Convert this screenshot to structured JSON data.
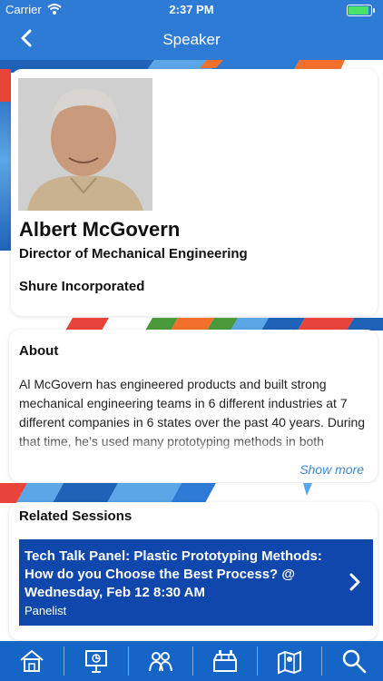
{
  "status_bar": {
    "carrier": "Carrier",
    "time": "2:37 PM"
  },
  "nav": {
    "title": "Speaker"
  },
  "speaker": {
    "name": "Albert McGovern",
    "job_title": "Director of Mechanical Engineering",
    "company": "Shure Incorporated"
  },
  "about": {
    "heading": "About",
    "text": "Al McGovern has engineered products and built strong mechanical engineering teams in 6 different industries at 7 different companies in 6 states over the past 40 years. During that time, he’s used many prototyping methods in both Research and in Product Development efforts. These include",
    "show_more": "Show more"
  },
  "related": {
    "heading": "Related Sessions",
    "sessions": [
      {
        "title": "Tech Talk Panel: Plastic Prototyping Methods: How do you Choose the Best Process? @ Wednesday, Feb 12 8:30 AM",
        "role": "Panelist"
      }
    ]
  },
  "tabs": [
    "home-icon",
    "presentation-icon",
    "people-icon",
    "exhibitors-icon",
    "map-icon",
    "search-icon"
  ],
  "colors": {
    "nav": "#2e7bd6",
    "session": "#0f47ad",
    "tab_bar": "#1565c7",
    "link": "#3b8ad8"
  }
}
